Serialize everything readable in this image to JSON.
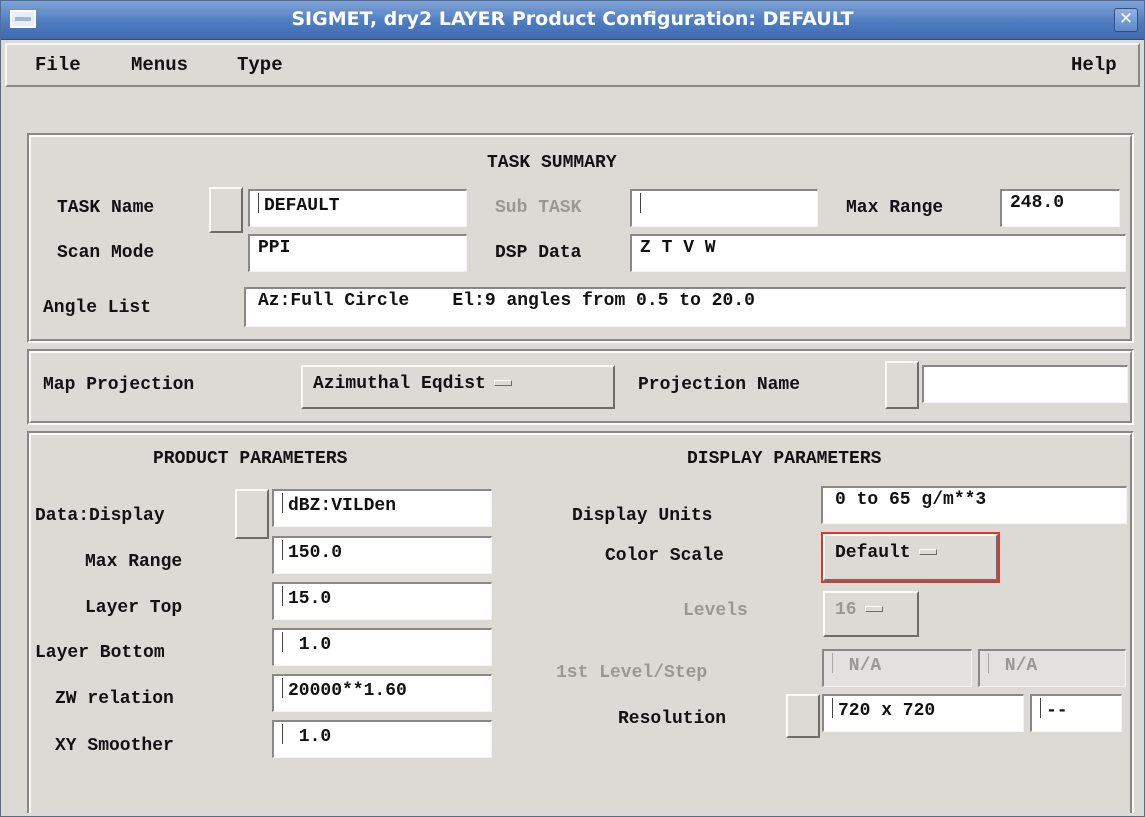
{
  "window": {
    "title": "SIGMET, dry2  LAYER Product Configuration: DEFAULT",
    "close_glyph": "✕"
  },
  "menubar": {
    "file": "File",
    "menus": "Menus",
    "type": "Type",
    "help": "Help"
  },
  "task_summary": {
    "heading": "TASK SUMMARY",
    "task_name_label": "TASK Name",
    "task_name_value": "DEFAULT",
    "sub_task_label": "Sub TASK",
    "sub_task_value": "",
    "max_range_label": "Max Range",
    "max_range_value": "248.0",
    "scan_mode_label": "Scan Mode",
    "scan_mode_value": "PPI",
    "dsp_data_label": "DSP Data",
    "dsp_data_value": "Z T V W",
    "angle_list_label": "Angle List",
    "angle_list_value": "Az:Full Circle    El:9 angles from 0.5 to 20.0"
  },
  "map": {
    "projection_label": "Map Projection",
    "projection_value": "Azimuthal Eqdist",
    "projection_name_label": "Projection Name",
    "projection_name_value": ""
  },
  "product_parameters": {
    "heading": "PRODUCT PARAMETERS",
    "data_display_label": "Data:Display",
    "data_display_value": "dBZ:VILDen",
    "max_range_label": "Max Range",
    "max_range_value": "150.0",
    "layer_top_label": "Layer Top",
    "layer_top_value": "15.0",
    "layer_bottom_label": "Layer Bottom",
    "layer_bottom_value": " 1.0",
    "zw_relation_label": "ZW relation",
    "zw_relation_value": "20000**1.60",
    "xy_smoother_label": "XY Smoother",
    "xy_smoother_value": " 1.0"
  },
  "display_parameters": {
    "heading": "DISPLAY PARAMETERS",
    "display_units_label": "Display Units",
    "display_units_value": "0 to 65 g/m**3",
    "color_scale_label": "Color Scale",
    "color_scale_value": "Default",
    "levels_label": "Levels",
    "levels_value": "16",
    "first_level_label": "1st Level/Step",
    "first_level_value": " N/A",
    "step_value": " N/A",
    "resolution_label": "Resolution",
    "resolution_value": "720 x 720",
    "resolution_extra_value": "--"
  },
  "colors": {
    "title_bar": "#4f7cc0",
    "highlight": "#e0352b",
    "window_bg": "#dcdad5"
  }
}
